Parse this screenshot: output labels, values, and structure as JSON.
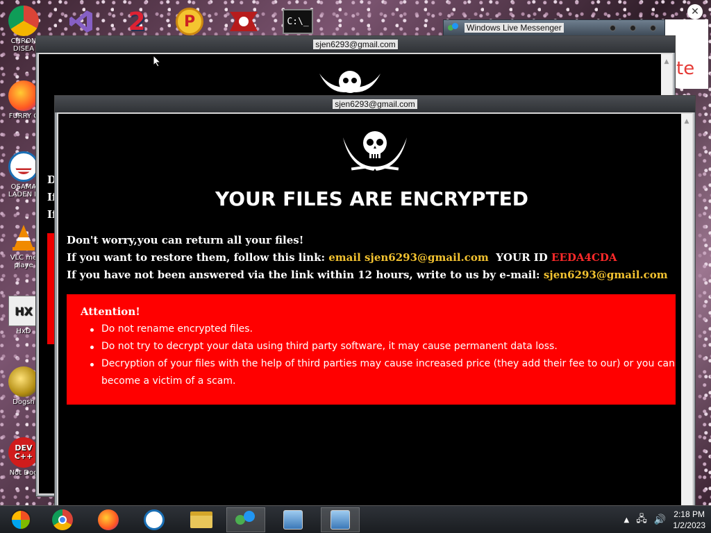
{
  "desktop": {
    "icons": [
      {
        "label": "CHRON DISEA",
        "name": "chrome-shortcut-icon",
        "color": "#e8453c"
      },
      {
        "label": "FURRY C",
        "name": "firefox-shortcut-icon",
        "color": "#ff7139"
      },
      {
        "label": "OSAMA LADEN B",
        "name": "obama-logo-icon",
        "color": "#1a6fb5"
      },
      {
        "label": "VLC me playe",
        "name": "vlc-icon",
        "color": "#f08a00"
      },
      {
        "label": "HxD",
        "name": "hxd-icon",
        "color": "#6a6a6a"
      },
      {
        "label": "Dogsh",
        "name": "dogsh-icon",
        "color": "#b0901a"
      },
      {
        "label": "Not Dog",
        "name": "dev-cpp-icon",
        "color": "#d01c1c"
      }
    ],
    "dev_glyph": "DEV C++",
    "hx_glyph": "HX"
  },
  "messenger": {
    "title": "Windows Live Messenger"
  },
  "windows": {
    "back_title": "sjen6293@gmail.com",
    "back_side": [
      "D",
      "If",
      "If"
    ],
    "front_title": "sjen6293@gmail.com"
  },
  "ransom": {
    "headline": "YOUR FILES ARE ENCRYPTED",
    "line1": "Don't worry,you can return all your files!",
    "line2_prefix": "If you want to restore them, follow this link:",
    "line2_link": "email sjen6293@gmail.com",
    "line2_id_label": "YOUR ID",
    "line2_id": "EEDA4CDA",
    "line3_prefix": "If you have not been answered via the link within 12 hours, write to us by e-mail:",
    "line3_email": "sjen6293@gmail.com",
    "attention_title": "Attention!",
    "bullets": [
      "Do not rename encrypted files.",
      "Do not try to decrypt your data using third party software, it may cause permanent data loss.",
      "Decryption of your files with the help of third parties may cause increased price (they add their fee to our) or you can become a victim of a scam."
    ]
  },
  "taskbar": {
    "time": "2:18 PM",
    "date": "1/2/2023"
  },
  "colors": {
    "accent_yellow": "#f2c230",
    "id_red": "#ff2a2a",
    "panel_red": "#ff0000"
  }
}
